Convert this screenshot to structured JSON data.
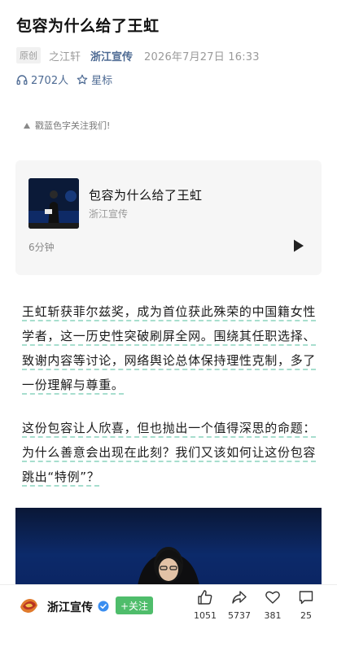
{
  "article": {
    "title": "包容为什么给了王虹",
    "tag": "原创",
    "author": "之江轩",
    "account": "浙江宣传",
    "date": "2026年7月27日 16:33",
    "listeners": "2702人",
    "star_label": "星标"
  },
  "follow_tip": "戳蓝色字关注我们!",
  "audio": {
    "title": "包容为什么给了王虹",
    "source": "浙江宣传",
    "duration": "6分钟"
  },
  "body": {
    "para1": "王虹斩获菲尔兹奖，成为首位获此殊荣的中国籍女性学者，这一历史性突破刷屏全网。围绕其任职选择、致谢内容等讨论，网络舆论总体保持理性克制，多了一份理解与尊重。",
    "para2": "这份包容让人欣喜，但也抛出一个值得深思的命题：为什么善意会出现在此刻？我们又该如何让这份包容跳出“特例”？"
  },
  "bottom_bar": {
    "account_name": "浙江宣传",
    "follow_label": "+关注",
    "likes": "1051",
    "shares": "5737",
    "favorites": "381",
    "comments": "25"
  },
  "icons": {
    "headphones": "headphones-icon",
    "star": "star-icon",
    "play": "play-icon",
    "verified": "verified-badge-icon",
    "like": "thumbs-up-icon",
    "share": "share-arrow-icon",
    "favorite": "heart-icon",
    "comment": "comment-icon"
  },
  "colors": {
    "link_blue": "#4d6a93",
    "follow_green": "#4fbd6b",
    "underline_green": "#8ad3bd"
  }
}
